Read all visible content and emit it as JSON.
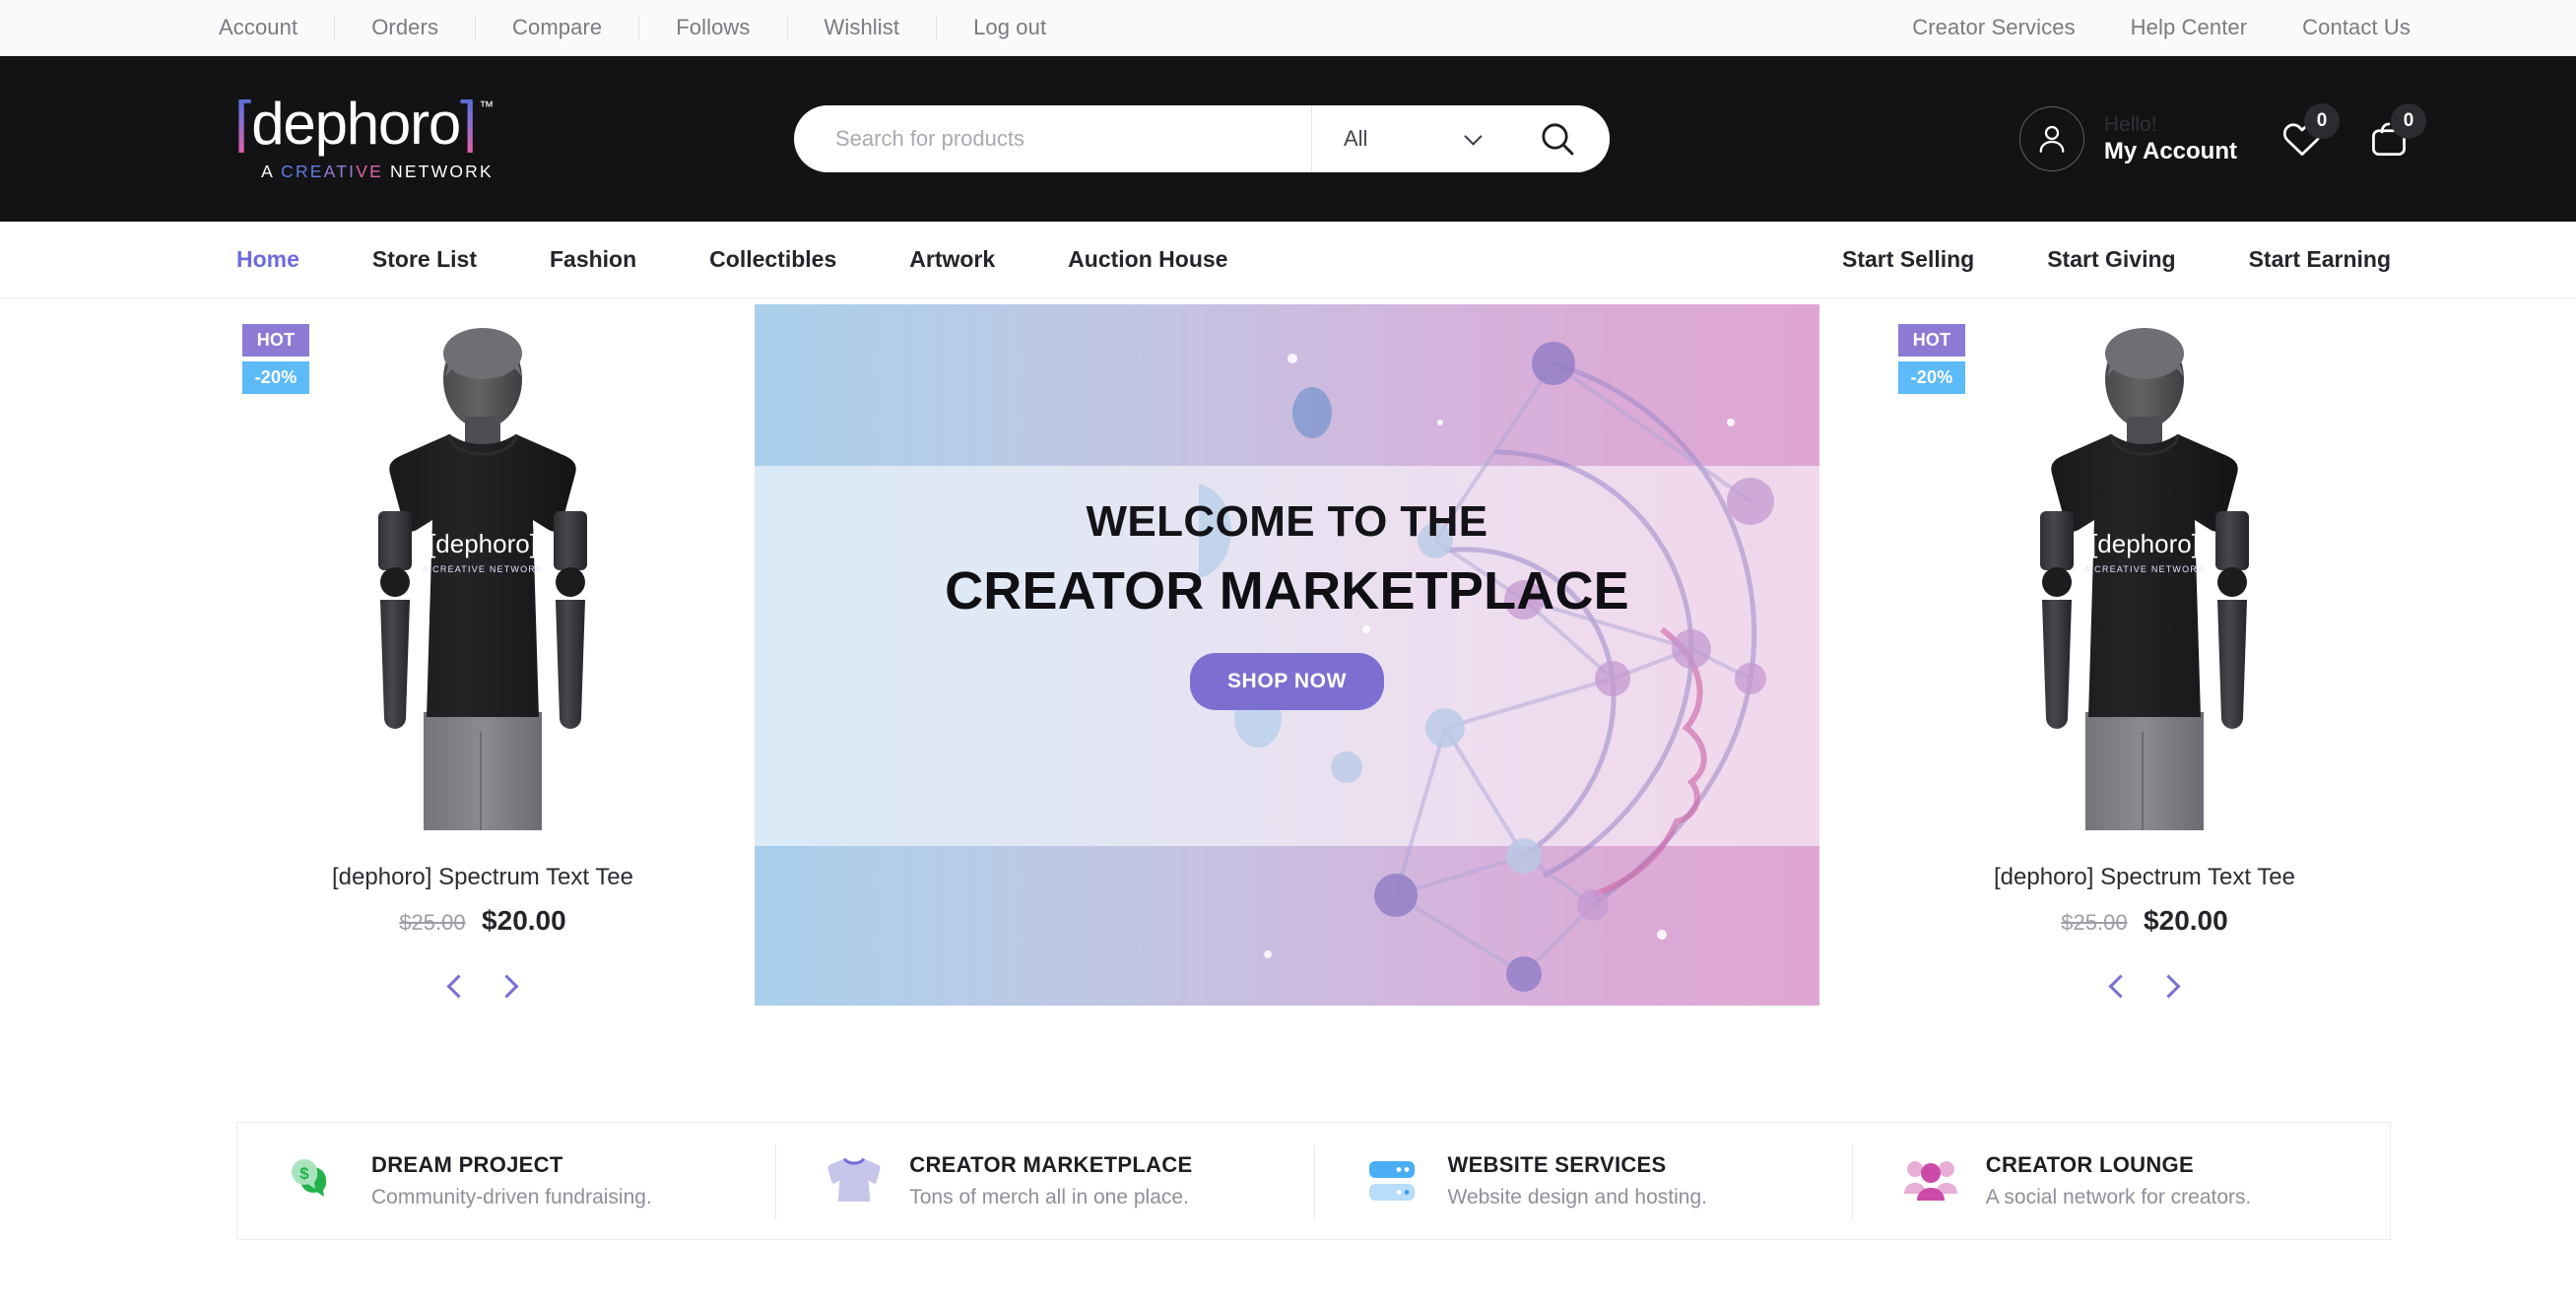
{
  "topbar": {
    "left_links": [
      "Account",
      "Orders",
      "Compare",
      "Follows",
      "Wishlist",
      "Log out"
    ],
    "right_links": [
      "Creator Services",
      "Help Center",
      "Contact Us"
    ]
  },
  "header": {
    "logo": {
      "bracket_open": "[",
      "word": "dephoro",
      "bracket_close": "]",
      "tm": "™",
      "tagline_a": "A ",
      "tagline_cre": "CRE",
      "tagline_ati": "ATI",
      "tagline_ve": "VE",
      "tagline_net": " NETWORK"
    },
    "search": {
      "placeholder": "Search for products",
      "value": "",
      "category": "All",
      "search_icon": "search-icon"
    },
    "account": {
      "hello": "Hello!",
      "name": "My Account",
      "wishlist_count": "0",
      "cart_count": "0"
    }
  },
  "nav": {
    "left": [
      "Home",
      "Store List",
      "Fashion",
      "Collectibles",
      "Artwork",
      "Auction House"
    ],
    "right": [
      "Start Selling",
      "Start Giving",
      "Start Earning"
    ],
    "active": "Home",
    "active_color": "#6d6ae0"
  },
  "products": [
    {
      "badge_hot": "HOT",
      "badge_discount": "-20%",
      "title": "[dephoro] Spectrum Text Tee",
      "price_old": "$25.00",
      "price_new": "$20.00",
      "prev_label": "previous-product",
      "next_label": "next-product"
    },
    {
      "badge_hot": "HOT",
      "badge_discount": "-20%",
      "title": "[dephoro] Spectrum Text Tee",
      "price_old": "$25.00",
      "price_new": "$20.00",
      "prev_label": "previous-product",
      "next_label": "next-product"
    }
  ],
  "hero": {
    "line1": "WELCOME TO THE",
    "line2": "CREATOR MARKETPLACE",
    "cta": "SHOP NOW",
    "cta_color": "#7d6fd1",
    "gradient_start": "#a9cfea",
    "gradient_end": "#dfa6d3"
  },
  "features": [
    {
      "icon": "money-chat-bubble-icon",
      "title": "DREAM PROJECT",
      "subtitle": "Community-driven fundraising.",
      "color": "#22b14c"
    },
    {
      "icon": "tshirt-icon",
      "title": "CREATOR MARKETPLACE",
      "subtitle": "Tons of merch all in one place.",
      "color": "#c3c0e8"
    },
    {
      "icon": "server-icon",
      "title": "WEBSITE SERVICES",
      "subtitle": "Website design and hosting.",
      "color": "#4aaef5"
    },
    {
      "icon": "people-group-icon",
      "title": "CREATOR LOUNGE",
      "subtitle": "A social network for creators.",
      "color": "#cc4aa8"
    }
  ]
}
